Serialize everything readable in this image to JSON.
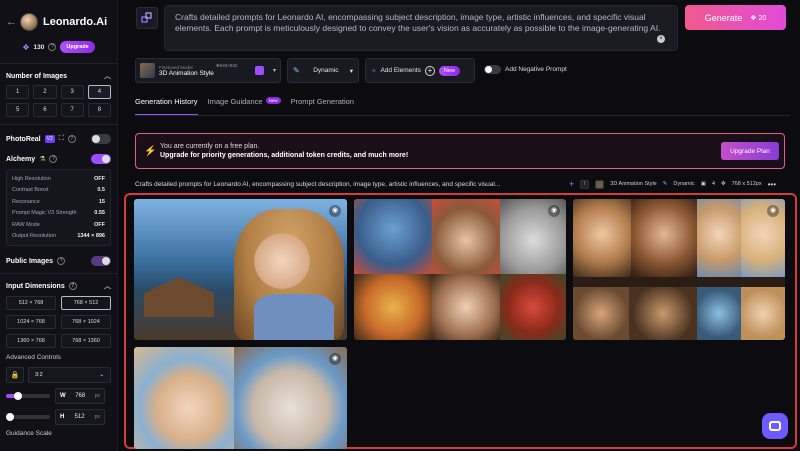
{
  "brand": {
    "name": "Leonardo.Ai",
    "tokens": "130",
    "upgrade_label": "Upgrade"
  },
  "sidebar": {
    "num_images_title": "Number of Images",
    "num_images": [
      "1",
      "2",
      "3",
      "4",
      "5",
      "6",
      "7",
      "8"
    ],
    "num_images_selected": "4",
    "photoreal_label": "PhotoReal",
    "photoreal_badge": "V2",
    "alchemy_label": "Alchemy",
    "alchemy_rows": [
      {
        "label": "High Resolution",
        "value": "OFF"
      },
      {
        "label": "Contrast Boost",
        "value": "0.5"
      },
      {
        "label": "Resonance",
        "value": "15"
      },
      {
        "label": "Prompt Magic V3 Strength",
        "value": "0.55"
      },
      {
        "label": "RAW Mode",
        "value": "OFF"
      },
      {
        "label": "Output Resolution",
        "value": "1344 × 896"
      }
    ],
    "public_images_label": "Public Images",
    "input_dimensions_title": "Input Dimensions",
    "dimensions": [
      "512 × 768",
      "768 × 512",
      "1024 × 768",
      "768 × 1024",
      "1360 × 768",
      "768 × 1360"
    ],
    "dimensions_selected": "768 × 512",
    "advanced_controls_label": "Advanced Controls",
    "aspect_ratio": "3:2",
    "width_label": "W",
    "width_value": "768",
    "height_label": "H",
    "height_value": "512",
    "unit": "px",
    "guidance_label": "Guidance Scale"
  },
  "prompt": {
    "text": "Crafts detailed prompts for Leonardo AI, encompassing subject description, image type, artistic influences, and specific visual elements. Each prompt is meticulously designed to convey the user's vision as accurately as possible to the image-generating AI."
  },
  "generate": {
    "label": "Generate",
    "cost": "20"
  },
  "toolbar": {
    "model_label": "Finetuned Model",
    "model_size": "640×832",
    "model_name": "3D Animation Style",
    "style": "Dynamic",
    "add_elements": "Add Elements",
    "new_badge": "New",
    "negative_prompt": "Add Negative Prompt"
  },
  "tabs": [
    {
      "label": "Generation History"
    },
    {
      "label": "Image Guidance",
      "badge": "New"
    },
    {
      "label": "Prompt Generation"
    }
  ],
  "banner": {
    "line1": "You are currently on a free plan.",
    "line2": "Upgrade for priority generations, additional token credits, and much more!",
    "button": "Upgrade Plan"
  },
  "generation": {
    "prompt": "Crafts detailed prompts for Leonardo AI, encompassing subject description, image type, artistic influences, and specific visual...",
    "model": "3D Animation Style",
    "style": "Dynamic",
    "count": "4",
    "size": "768 x 512px"
  },
  "colors": {
    "accent": "#9c4dff",
    "generate_start": "#f05a8e",
    "generate_end": "#e14ad8",
    "highlight_frame": "#d63a3a"
  }
}
